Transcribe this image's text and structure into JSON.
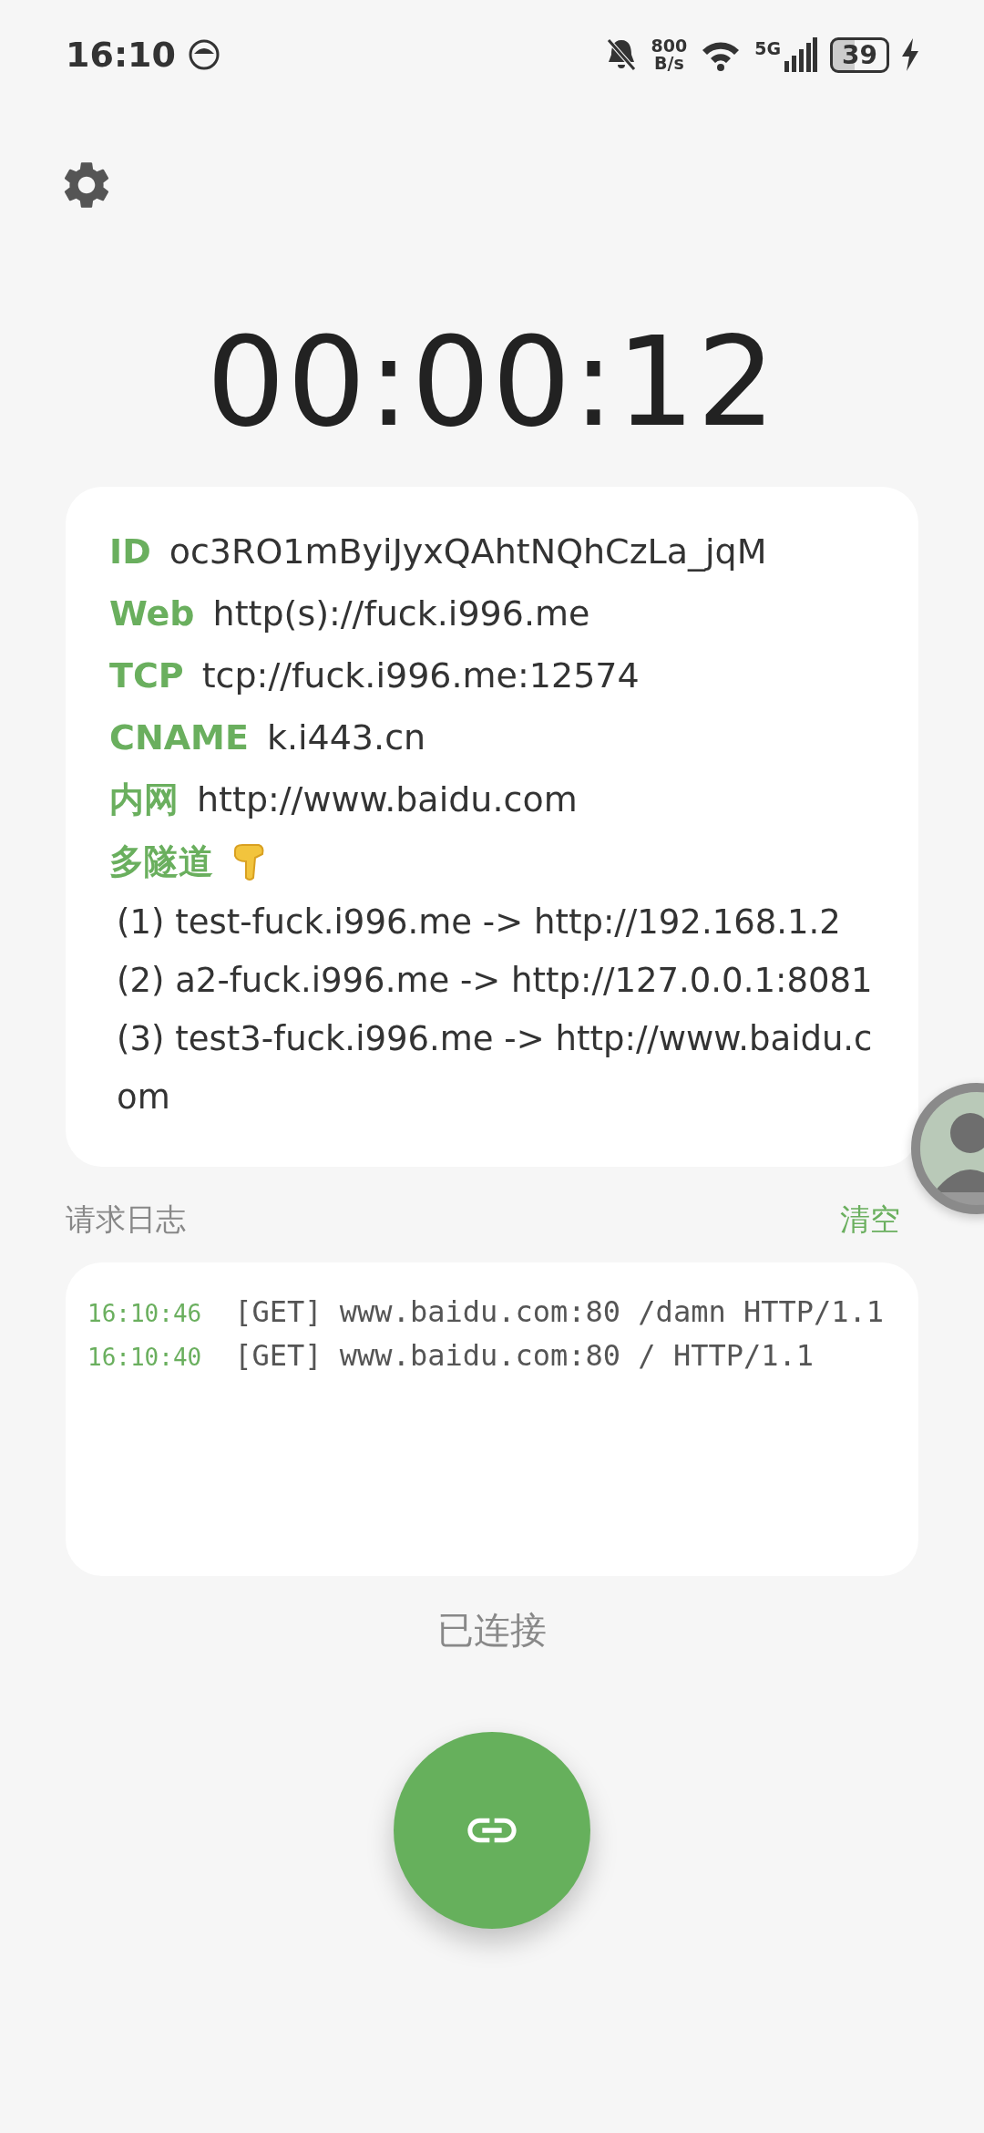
{
  "status_bar": {
    "time": "16:10",
    "net_speed": "800",
    "net_unit": "B/s",
    "network": "5G",
    "battery": "39",
    "charging": true
  },
  "timer": "00:00:12",
  "info": [
    {
      "label": "ID",
      "value": "oc3RO1mByiJyxQAhtNQhCzLa_jqM"
    },
    {
      "label": "Web",
      "value": "http(s)://fuck.i996.me"
    },
    {
      "label": "TCP",
      "value": "tcp://fuck.i996.me:12574"
    },
    {
      "label": "CNAME",
      "value": "k.i443.cn"
    },
    {
      "label": "内网",
      "value": "http://www.baidu.com"
    }
  ],
  "tunnels": {
    "label": "多隧道",
    "items": [
      "(1) test-fuck.i996.me -> http://192.168.1.2",
      "(2) a2-fuck.i996.me -> http://127.0.0.1:8081",
      "(3) test3-fuck.i996.me -> http://www.baidu.com"
    ]
  },
  "log": {
    "title": "请求日志",
    "clear": "清空",
    "entries": [
      {
        "time": "16:10:46",
        "text": "[GET] www.baidu.com:80 /damn HTTP/1.1"
      },
      {
        "time": "16:10:40",
        "text": "[GET] www.baidu.com:80 / HTTP/1.1"
      }
    ]
  },
  "status": "已连接",
  "connected": true
}
